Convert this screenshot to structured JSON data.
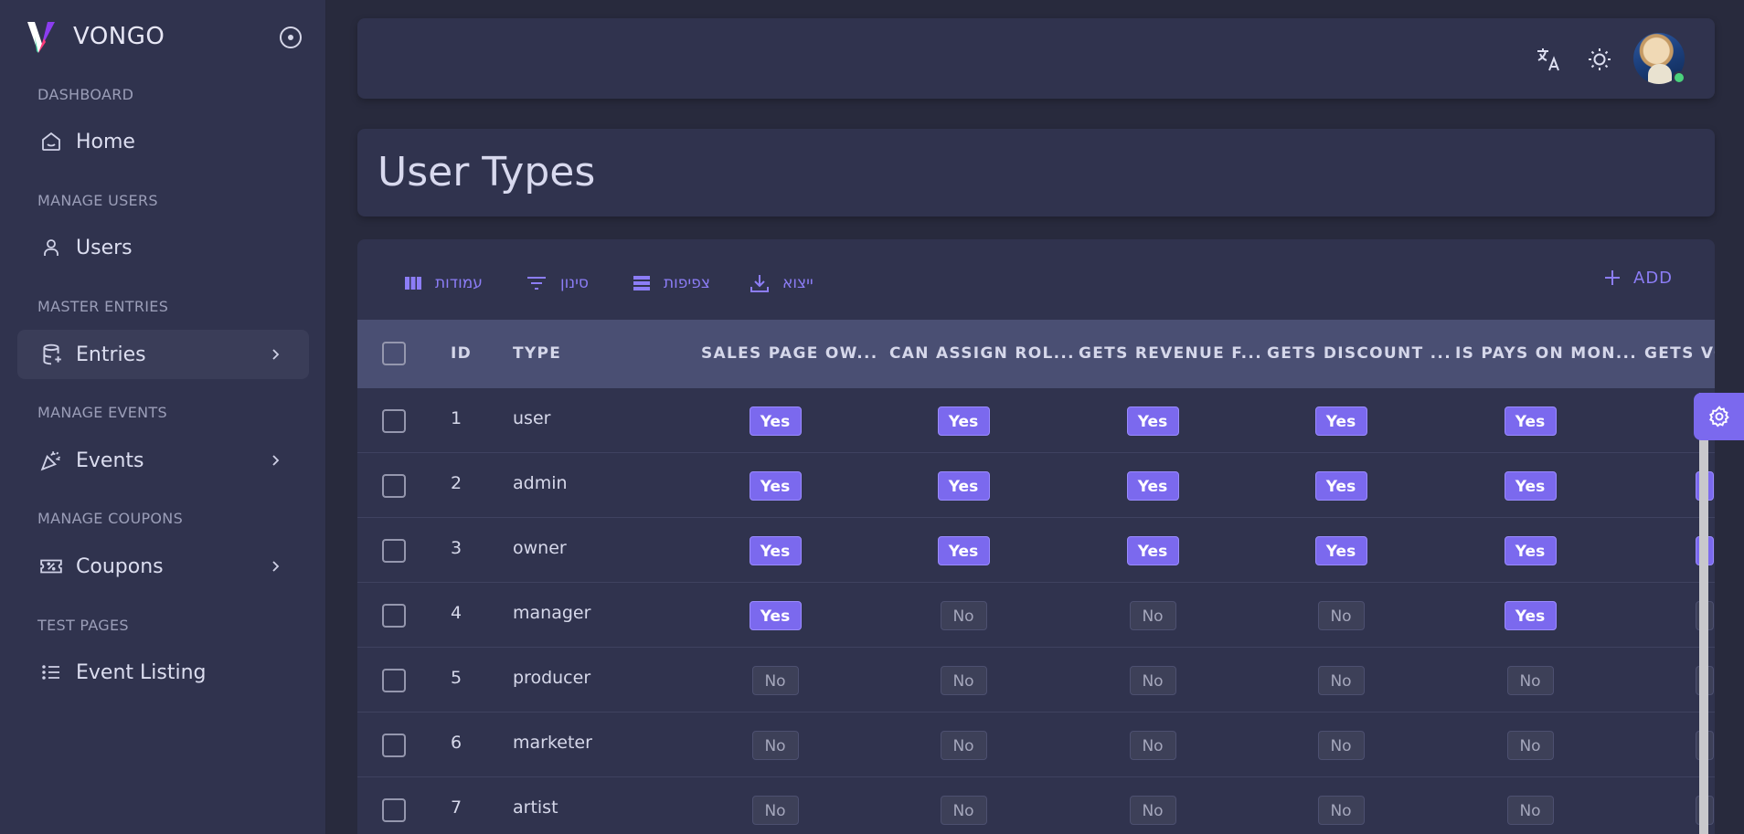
{
  "brand": {
    "name": "VONGO"
  },
  "sidebar": {
    "sections": [
      {
        "label": "DASHBOARD",
        "items": [
          {
            "label": "Home",
            "icon": "home-icon",
            "has_children": false
          }
        ]
      },
      {
        "label": "MANAGE USERS",
        "items": [
          {
            "label": "Users",
            "icon": "user-icon",
            "has_children": false
          }
        ]
      },
      {
        "label": "MASTER ENTRIES",
        "items": [
          {
            "label": "Entries",
            "icon": "database-icon",
            "has_children": true,
            "active": true
          }
        ]
      },
      {
        "label": "MANAGE EVENTS",
        "items": [
          {
            "label": "Events",
            "icon": "party-popper-icon",
            "has_children": true
          }
        ]
      },
      {
        "label": "MANAGE COUPONS",
        "items": [
          {
            "label": "Coupons",
            "icon": "ticket-icon",
            "has_children": true
          }
        ]
      },
      {
        "label": "TEST PAGES",
        "items": [
          {
            "label": "Event Listing",
            "icon": "list-icon",
            "has_children": false
          }
        ]
      }
    ]
  },
  "header": {
    "icons": [
      "translate-icon",
      "sun-icon"
    ],
    "avatar_status": "online"
  },
  "page": {
    "title": "User Types"
  },
  "toolbar": {
    "columns_label": "עמודות",
    "filter_label": "סינון",
    "density_label": "צפיפות",
    "export_label": "ייצוא",
    "add_label": "ADD"
  },
  "table": {
    "columns": [
      "ID",
      "TYPE",
      "SALES PAGE OW...",
      "CAN ASSIGN ROL...",
      "GETS REVENUE F...",
      "GETS DISCOUNT ...",
      "IS PAYS ON MON...",
      "GETS VO"
    ],
    "rows": [
      {
        "id": "1",
        "type": "user",
        "flags": [
          "Yes",
          "Yes",
          "Yes",
          "Yes",
          "Yes"
        ]
      },
      {
        "id": "2",
        "type": "admin",
        "flags": [
          "Yes",
          "Yes",
          "Yes",
          "Yes",
          "Yes"
        ]
      },
      {
        "id": "3",
        "type": "owner",
        "flags": [
          "Yes",
          "Yes",
          "Yes",
          "Yes",
          "Yes"
        ]
      },
      {
        "id": "4",
        "type": "manager",
        "flags": [
          "Yes",
          "No",
          "No",
          "No",
          "Yes"
        ]
      },
      {
        "id": "5",
        "type": "producer",
        "flags": [
          "No",
          "No",
          "No",
          "No",
          "No"
        ]
      },
      {
        "id": "6",
        "type": "marketer",
        "flags": [
          "No",
          "No",
          "No",
          "No",
          "No"
        ]
      },
      {
        "id": "7",
        "type": "artist",
        "flags": [
          "No",
          "No",
          "No",
          "No",
          "No"
        ]
      }
    ]
  },
  "colors": {
    "accent": "#7b69ee",
    "background": "#282a3d",
    "card": "#30334e",
    "table_header": "#4a4f73"
  }
}
